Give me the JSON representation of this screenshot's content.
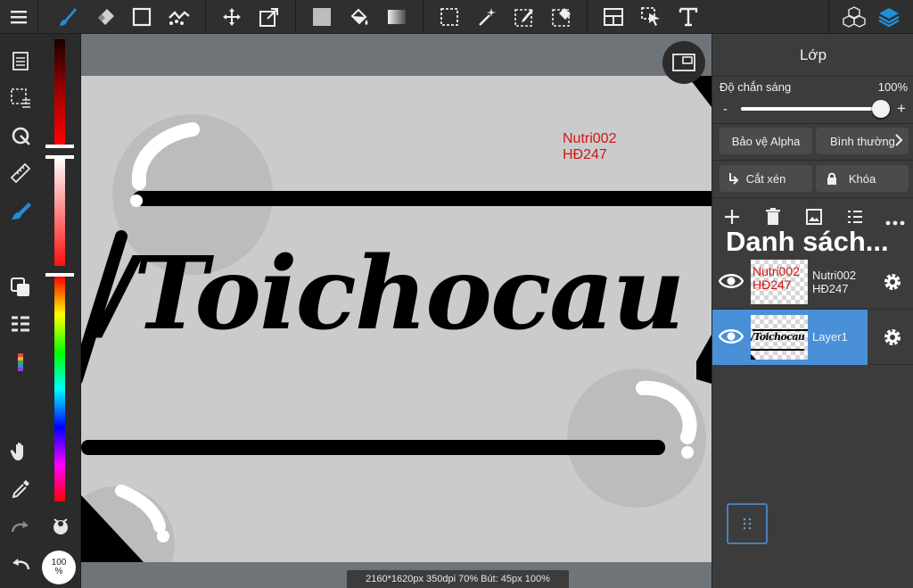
{
  "canvas": {
    "watermark_line1": "Nutri002",
    "watermark_line2": "HĐ247",
    "artwork_text": "/Toichocau",
    "status": "2160*1620px 350dpi 70% Bút: 45px 100%"
  },
  "left_toolbar": {
    "brush_size_badge_top": "100",
    "brush_size_badge_bottom": "%"
  },
  "panel": {
    "title": "Lớp",
    "opacity_label": "Độ chắn sáng",
    "opacity_value": "100%",
    "opacity_level": 1.0,
    "minus_label": "-",
    "plus_label": "+",
    "protect_alpha_label": "Bảo vệ Alpha",
    "blend_mode_label": "Bình thường",
    "clip_label": "Cắt xén",
    "lock_label": "Khóa",
    "list_heading": "Danh sách...",
    "layers": [
      {
        "name_line1": "Nutri002",
        "name_line2": "HĐ247",
        "thumb_line1": "Nutri002",
        "thumb_line2": "HĐ247",
        "selected": false
      },
      {
        "name_line1": "Layer1",
        "name_line2": "",
        "thumb_text": "/Toichocau",
        "selected": true
      }
    ]
  },
  "colors": {
    "accent": "#1e8fd8",
    "selected_layer": "#4a90d9",
    "watermark_red": "#d01616",
    "artboard": "#cbcbcb"
  }
}
